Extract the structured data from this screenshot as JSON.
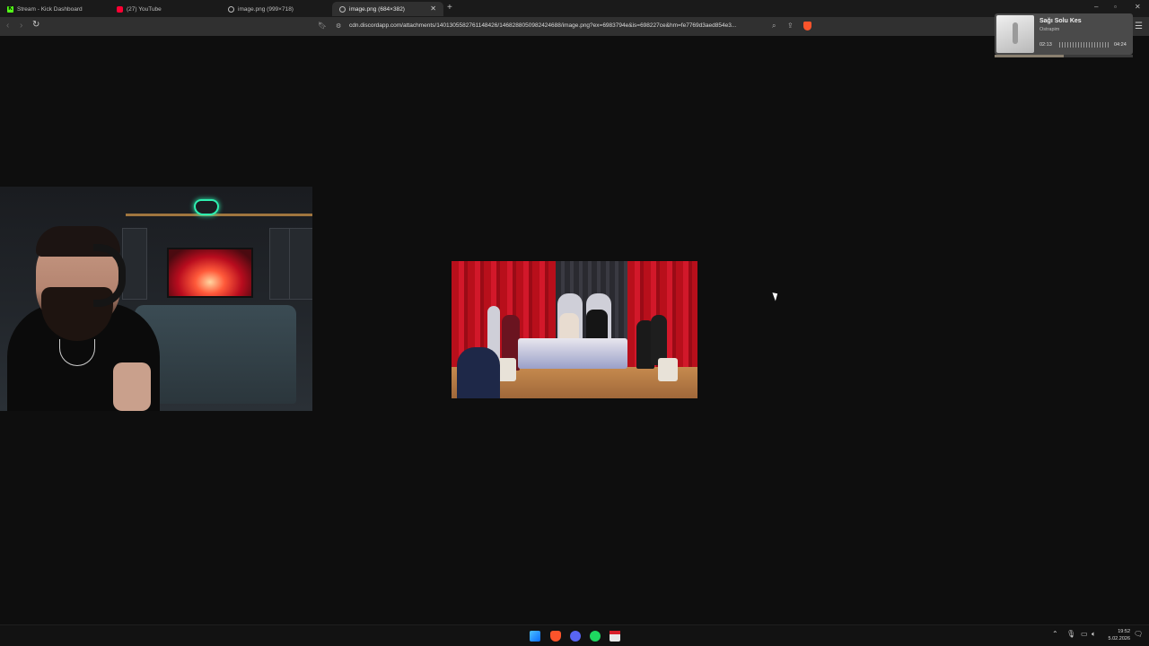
{
  "browser": {
    "tabs": [
      {
        "title": "Stream - Kick Dashboard",
        "favicon": "kick-icon",
        "active": false
      },
      {
        "title": "(27) YouTube",
        "favicon": "youtube-icon",
        "active": false
      },
      {
        "title": "image.png (999×718)",
        "favicon": "globe-icon",
        "active": false
      },
      {
        "title": "image.png (684×382)",
        "favicon": "globe-icon",
        "active": true
      }
    ],
    "new_tab_label": "+",
    "url": "cdn.discordapp.com/attachments/1401305582761148426/1468288050982424688/image.png?ex=6983794e&is=698227ce&hm=fe7769d3aed854e3...",
    "window_controls": {
      "minimize": "–",
      "restore": "▫",
      "close": "✕"
    }
  },
  "media_player": {
    "song_title": "Sağı Solu Kes",
    "artist": "Ostrapim",
    "time_elapsed": "02:13",
    "time_total": "04:24",
    "progress": 0.5
  },
  "taskbar": {
    "time": "19:52",
    "date": "5.02.2026",
    "apps": [
      "windows-start-icon",
      "brave-icon",
      "discord-icon",
      "spotify-icon",
      "calendar-app-icon"
    ]
  },
  "colors": {
    "page_bg": "#0e0e0e",
    "tabbar_bg": "#1a1a1a",
    "active_tab": "#303030",
    "brave_accent": "#fb542b"
  }
}
